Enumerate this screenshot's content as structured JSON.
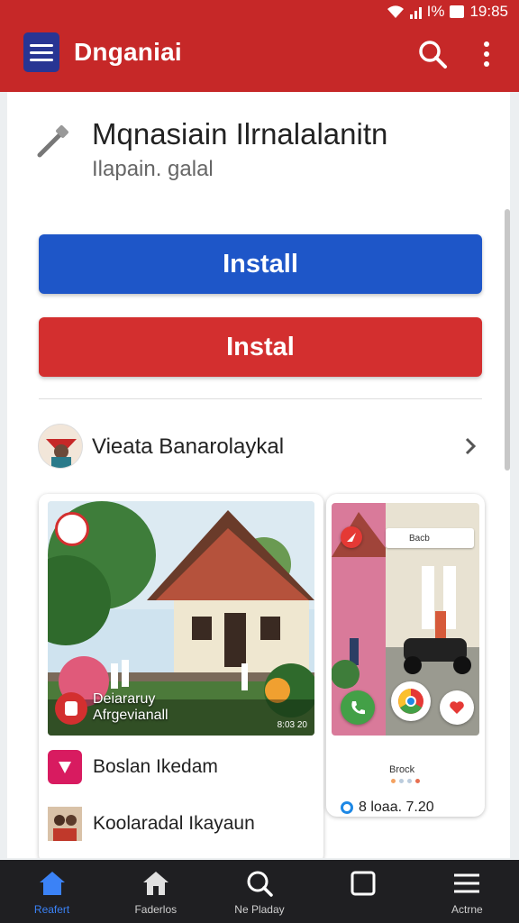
{
  "status_bar": {
    "network": "I%",
    "time": "19:85"
  },
  "app_bar": {
    "title": "Dnganiai"
  },
  "app_info": {
    "name": "Mqnasiain Ilrnalalanitn",
    "subtitle": "Ilapain. galal"
  },
  "buttons": {
    "install_primary": "Install",
    "install_secondary": "Instal"
  },
  "developer": {
    "name": "Vieata Banarolaykal"
  },
  "screenshot_card": {
    "caption_line1": "Deiararuy",
    "caption_line2": "Afrgevianall",
    "timestamp": "8:03 20",
    "list": [
      {
        "label": "Boslan Ikedam",
        "icon": "shield-icon"
      },
      {
        "label": "Koolaradal Ikayaun",
        "icon": "avatar-icon"
      }
    ]
  },
  "phone_card": {
    "bar_label": "Bacb",
    "caption": "Brock",
    "size_text": "8 loaa. 7.20"
  },
  "bottom_nav": [
    {
      "label": "Reafert",
      "icon": "home-icon",
      "active": true
    },
    {
      "label": "Faderlos",
      "icon": "home-outline-icon",
      "active": false
    },
    {
      "label": "Ne Pladay",
      "icon": "search-icon",
      "active": false
    },
    {
      "label": "",
      "icon": "square-icon",
      "active": false
    },
    {
      "label": "Actrne",
      "icon": "menu-icon",
      "active": false
    }
  ],
  "colors": {
    "app_bar": "#c62828",
    "install_primary": "#1e56c8",
    "install_secondary": "#d32f2f",
    "nav_active": "#3b82f6"
  }
}
